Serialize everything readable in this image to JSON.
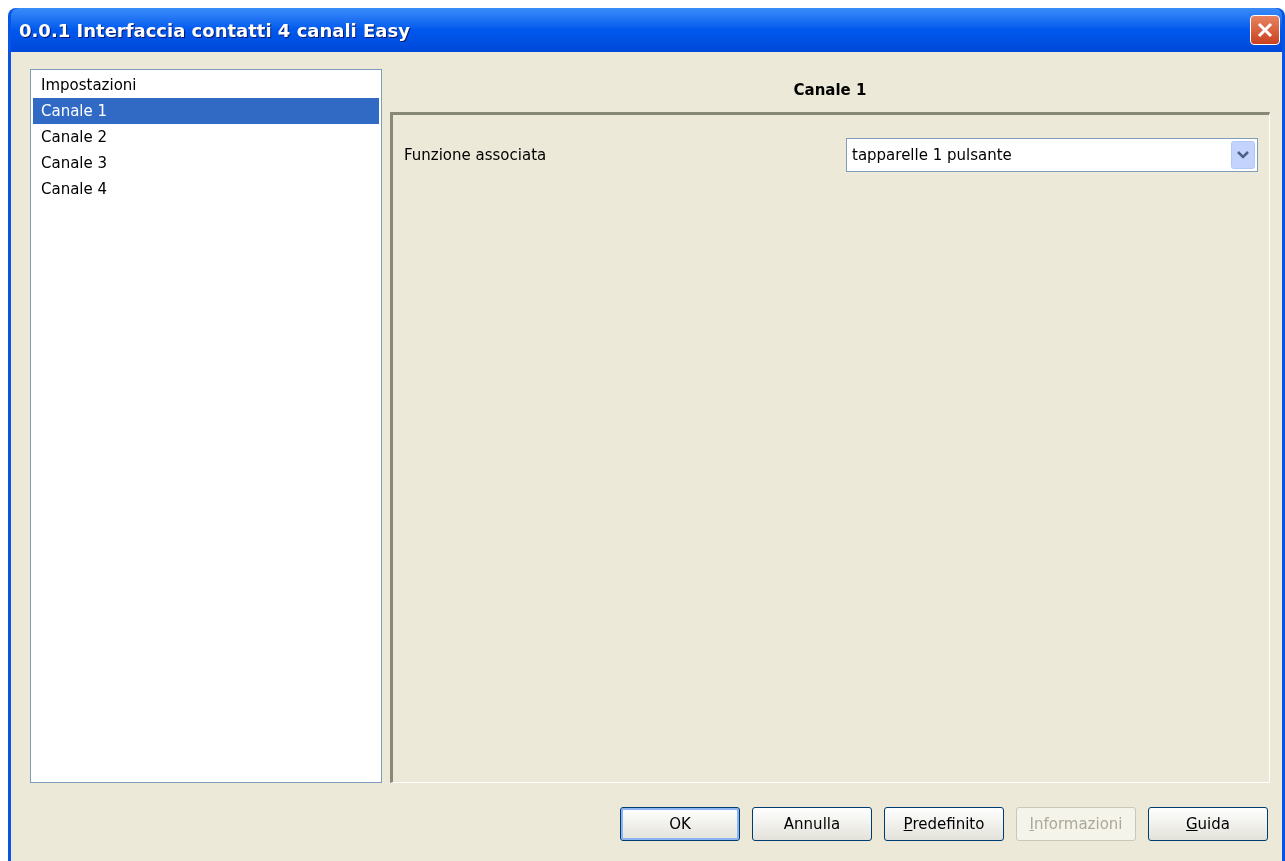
{
  "window": {
    "title": "0.0.1 Interfaccia contatti 4 canali Easy"
  },
  "sidebar": {
    "items": [
      {
        "label": "Impostazioni",
        "selected": false
      },
      {
        "label": "Canale 1",
        "selected": true
      },
      {
        "label": "Canale 2",
        "selected": false
      },
      {
        "label": "Canale 3",
        "selected": false
      },
      {
        "label": "Canale 4",
        "selected": false
      }
    ]
  },
  "panel": {
    "title": "Canale 1",
    "fields": [
      {
        "label": "Funzione associata",
        "value": "tapparelle 1 pulsante"
      }
    ]
  },
  "buttons": [
    {
      "label": "OK",
      "default": true,
      "disabled": false,
      "underline_first": false
    },
    {
      "label": "Annulla",
      "default": false,
      "disabled": false,
      "underline_first": false
    },
    {
      "label": "Predefinito",
      "default": false,
      "disabled": false,
      "underline_first": true
    },
    {
      "label": "Informazioni",
      "default": false,
      "disabled": true,
      "underline_first": true
    },
    {
      "label": "Guida",
      "default": false,
      "disabled": false,
      "underline_first": true
    }
  ]
}
